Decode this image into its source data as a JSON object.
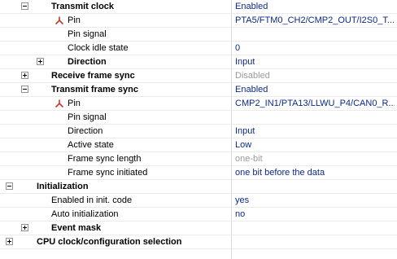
{
  "properties": [
    {
      "id": "transmit-clock",
      "label": "Transmit clock",
      "value": "Enabled",
      "bold": true,
      "expander": "minus",
      "value_style": "normal"
    },
    {
      "id": "transmit-clock-pin",
      "label": "Pin",
      "value": "PTA5/FTM0_CH2/CMP2_OUT/I2S0_T...",
      "bold": false,
      "expander": "none",
      "icon": "pin-icon",
      "value_style": "normal"
    },
    {
      "id": "transmit-clock-pin-signal",
      "label": "Pin signal",
      "value": "",
      "bold": false,
      "expander": "none",
      "value_style": "normal"
    },
    {
      "id": "clock-idle-state",
      "label": "Clock idle state",
      "value": "0",
      "bold": false,
      "expander": "none",
      "value_style": "normal"
    },
    {
      "id": "direction-group",
      "label": "Direction",
      "value": "Input",
      "bold": true,
      "expander": "plus",
      "value_style": "normal"
    },
    {
      "id": "receive-frame-sync",
      "label": "Receive frame sync",
      "value": "Disabled",
      "bold": true,
      "expander": "plus",
      "value_style": "disabled"
    },
    {
      "id": "transmit-frame-sync",
      "label": "Transmit frame sync",
      "value": "Enabled",
      "bold": true,
      "expander": "minus",
      "value_style": "normal"
    },
    {
      "id": "transmit-frame-sync-pin",
      "label": "Pin",
      "value": "CMP2_IN1/PTA13/LLWU_P4/CAN0_R...",
      "bold": false,
      "expander": "none",
      "icon": "pin-icon",
      "value_style": "normal"
    },
    {
      "id": "transmit-frame-sync-pin-signal",
      "label": "Pin signal",
      "value": "",
      "bold": false,
      "expander": "none",
      "value_style": "normal"
    },
    {
      "id": "direction",
      "label": "Direction",
      "value": "Input",
      "bold": false,
      "expander": "none",
      "value_style": "normal"
    },
    {
      "id": "active-state",
      "label": "Active state",
      "value": "Low",
      "bold": false,
      "expander": "none",
      "value_style": "normal"
    },
    {
      "id": "frame-sync-length",
      "label": "Frame sync length",
      "value": "one-bit",
      "bold": false,
      "expander": "none",
      "value_style": "disabled"
    },
    {
      "id": "frame-sync-initiated",
      "label": "Frame sync initiated",
      "value": "one bit before the data",
      "bold": false,
      "expander": "none",
      "value_style": "normal"
    },
    {
      "id": "initialization",
      "label": "Initialization",
      "value": "",
      "bold": true,
      "expander": "minus",
      "value_style": "normal"
    },
    {
      "id": "enabled-in-init-code",
      "label": "Enabled in init. code",
      "value": "yes",
      "bold": false,
      "expander": "none",
      "value_style": "normal"
    },
    {
      "id": "auto-initialization",
      "label": "Auto initialization",
      "value": "no",
      "bold": false,
      "expander": "none",
      "value_style": "normal"
    },
    {
      "id": "event-mask",
      "label": "Event mask",
      "value": "",
      "bold": true,
      "expander": "plus",
      "value_style": "normal"
    },
    {
      "id": "cpu-clock-configuration-selection",
      "label": "CPU clock/configuration selection",
      "value": "",
      "bold": true,
      "expander": "plus",
      "value_style": "normal"
    }
  ],
  "colors": {
    "value_text": "#0b2a8a",
    "disabled_text": "#9a9a9a",
    "grid_line": "#ebebeb",
    "pin_icon": "#c0392b"
  }
}
